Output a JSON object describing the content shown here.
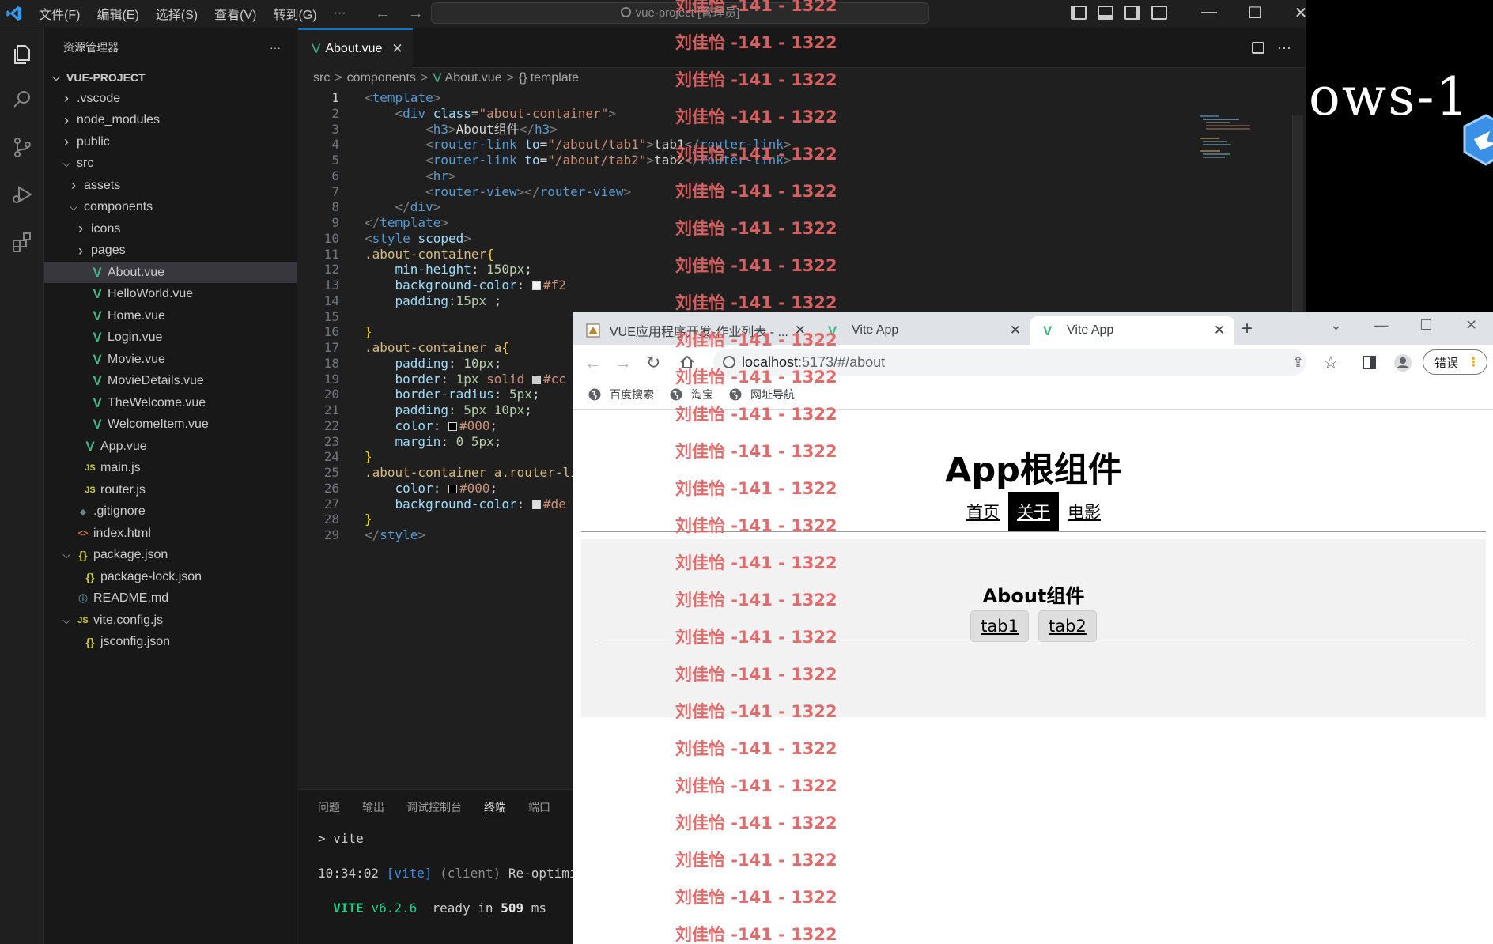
{
  "vscode": {
    "menu": [
      "文件(F)",
      "编辑(E)",
      "选择(S)",
      "查看(V)",
      "转到(G)"
    ],
    "more_label": "···",
    "nav_back": "←",
    "nav_forward": "→",
    "search_text": "vue-project [管理员]",
    "win_min": "—",
    "win_max": "☐",
    "win_close": "✕",
    "explorer_title": "资源管理器",
    "explorer_more": "···",
    "project_name": "VUE-PROJECT",
    "tree": [
      {
        "label": ".vscode",
        "kind": "folder",
        "open": false
      },
      {
        "label": "node_modules",
        "kind": "folder",
        "open": false
      },
      {
        "label": "public",
        "kind": "folder",
        "open": false
      },
      {
        "label": "src",
        "kind": "folder",
        "open": true
      },
      {
        "label": "assets",
        "kind": "folder",
        "open": false
      },
      {
        "label": "components",
        "kind": "folder",
        "open": true
      },
      {
        "label": "icons",
        "kind": "folder",
        "open": false
      },
      {
        "label": "pages",
        "kind": "folder",
        "open": false
      },
      {
        "label": "About.vue",
        "kind": "vue",
        "active": true
      },
      {
        "label": "HelloWorld.vue",
        "kind": "vue"
      },
      {
        "label": "Home.vue",
        "kind": "vue"
      },
      {
        "label": "Login.vue",
        "kind": "vue"
      },
      {
        "label": "Movie.vue",
        "kind": "vue"
      },
      {
        "label": "MovieDetails.vue",
        "kind": "vue"
      },
      {
        "label": "TheWelcome.vue",
        "kind": "vue"
      },
      {
        "label": "WelcomeItem.vue",
        "kind": "vue"
      },
      {
        "label": "App.vue",
        "kind": "vue"
      },
      {
        "label": "main.js",
        "kind": "js"
      },
      {
        "label": "router.js",
        "kind": "js"
      },
      {
        "label": ".gitignore",
        "kind": "git"
      },
      {
        "label": "index.html",
        "kind": "html"
      },
      {
        "label": "package.json",
        "kind": "json",
        "open": true
      },
      {
        "label": "package-lock.json",
        "kind": "json"
      },
      {
        "label": "README.md",
        "kind": "info"
      },
      {
        "label": "vite.config.js",
        "kind": "js",
        "open": true
      },
      {
        "label": "jsconfig.json",
        "kind": "json"
      }
    ],
    "tree_icons": {
      "vue": "V",
      "js": "JS",
      "json": "{}",
      "html": "<>",
      "info": "ⓘ",
      "git": "◆"
    },
    "tab_label": "About.vue",
    "tab_close": "✕",
    "breadcrumb": [
      "src",
      "components",
      "About.vue",
      "template"
    ],
    "breadcrumb_sep": ">",
    "code": [
      [
        [
          "brk",
          "<"
        ],
        [
          "tag",
          "template"
        ],
        [
          "brk",
          ">"
        ]
      ],
      [
        [
          "txt",
          "    "
        ],
        [
          "brk",
          "<"
        ],
        [
          "tag",
          "div"
        ],
        [
          "txt",
          " "
        ],
        [
          "attr",
          "class"
        ],
        [
          "txt",
          "="
        ],
        [
          "str",
          "\"about-container\""
        ],
        [
          "brk",
          ">"
        ]
      ],
      [
        [
          "txt",
          "        "
        ],
        [
          "brk",
          "<"
        ],
        [
          "tag",
          "h3"
        ],
        [
          "brk",
          ">"
        ],
        [
          "txt",
          "About组件"
        ],
        [
          "brk",
          "</"
        ],
        [
          "tag",
          "h3"
        ],
        [
          "brk",
          ">"
        ]
      ],
      [
        [
          "txt",
          "        "
        ],
        [
          "brk",
          "<"
        ],
        [
          "tag",
          "router-link"
        ],
        [
          "txt",
          " "
        ],
        [
          "attr",
          "to"
        ],
        [
          "txt",
          "="
        ],
        [
          "str",
          "\"/about/tab1\""
        ],
        [
          "brk",
          ">"
        ],
        [
          "txt",
          "tab1"
        ],
        [
          "brk",
          "</"
        ],
        [
          "tag",
          "router-link"
        ],
        [
          "brk",
          ">"
        ]
      ],
      [
        [
          "txt",
          "        "
        ],
        [
          "brk",
          "<"
        ],
        [
          "tag",
          "router-link"
        ],
        [
          "txt",
          " "
        ],
        [
          "attr",
          "to"
        ],
        [
          "txt",
          "="
        ],
        [
          "str",
          "\"/about/tab2\""
        ],
        [
          "brk",
          ">"
        ],
        [
          "txt",
          "tab2"
        ],
        [
          "brk",
          "</"
        ],
        [
          "tag",
          "router-link"
        ],
        [
          "brk",
          ">"
        ]
      ],
      [
        [
          "txt",
          "        "
        ],
        [
          "brk",
          "<"
        ],
        [
          "tag",
          "hr"
        ],
        [
          "brk",
          ">"
        ]
      ],
      [
        [
          "txt",
          "        "
        ],
        [
          "brk",
          "<"
        ],
        [
          "tag",
          "router-view"
        ],
        [
          "brk",
          "></"
        ],
        [
          "tag",
          "router-view"
        ],
        [
          "brk",
          ">"
        ]
      ],
      [
        [
          "txt",
          "    "
        ],
        [
          "brk",
          "</"
        ],
        [
          "tag",
          "div"
        ],
        [
          "brk",
          ">"
        ]
      ],
      [
        [
          "brk",
          "</"
        ],
        [
          "tag",
          "template"
        ],
        [
          "brk",
          ">"
        ]
      ],
      [
        [
          "brk",
          "<"
        ],
        [
          "tag",
          "style"
        ],
        [
          "txt",
          " "
        ],
        [
          "attr",
          "scoped"
        ],
        [
          "brk",
          ">"
        ]
      ],
      [
        [
          "sel",
          ".about-container"
        ],
        [
          "fold",
          "{"
        ]
      ],
      [
        [
          "txt",
          "    "
        ],
        [
          "attr",
          "min-height"
        ],
        [
          "txt",
          ": "
        ],
        [
          "num",
          "150px"
        ],
        [
          "txt",
          ";"
        ]
      ],
      [
        [
          "txt",
          "    "
        ],
        [
          "attr",
          "background-color"
        ],
        [
          "txt",
          ": "
        ],
        [
          "sw",
          "#f2f2f2"
        ],
        [
          "str",
          "#f2"
        ]
      ],
      [
        [
          "txt",
          "    "
        ],
        [
          "attr",
          "padding"
        ],
        [
          "txt",
          ":"
        ],
        [
          "num",
          "15px"
        ],
        [
          "txt",
          " ;"
        ]
      ],
      [],
      [
        [
          "fold",
          "}"
        ]
      ],
      [
        [
          "sel",
          ".about-container a"
        ],
        [
          "fold",
          "{"
        ]
      ],
      [
        [
          "txt",
          "    "
        ],
        [
          "attr",
          "padding"
        ],
        [
          "txt",
          ": "
        ],
        [
          "num",
          "10px"
        ],
        [
          "txt",
          ";"
        ]
      ],
      [
        [
          "txt",
          "    "
        ],
        [
          "attr",
          "border"
        ],
        [
          "txt",
          ": "
        ],
        [
          "num",
          "1px"
        ],
        [
          "txt",
          " "
        ],
        [
          "str",
          "solid"
        ],
        [
          "txt",
          " "
        ],
        [
          "sw",
          "#cccccc"
        ],
        [
          "str",
          "#cc"
        ]
      ],
      [
        [
          "txt",
          "    "
        ],
        [
          "attr",
          "border-radius"
        ],
        [
          "txt",
          ": "
        ],
        [
          "num",
          "5px"
        ],
        [
          "txt",
          ";"
        ]
      ],
      [
        [
          "txt",
          "    "
        ],
        [
          "attr",
          "padding"
        ],
        [
          "txt",
          ": "
        ],
        [
          "num",
          "5px 10px"
        ],
        [
          "txt",
          ";"
        ]
      ],
      [
        [
          "txt",
          "    "
        ],
        [
          "attr",
          "color"
        ],
        [
          "txt",
          ": "
        ],
        [
          "sw",
          "#000000"
        ],
        [
          "str",
          "#000"
        ],
        [
          "txt",
          ";"
        ]
      ],
      [
        [
          "txt",
          "    "
        ],
        [
          "attr",
          "margin"
        ],
        [
          "txt",
          ": "
        ],
        [
          "num",
          "0 5px"
        ],
        [
          "txt",
          ";"
        ]
      ],
      [
        [
          "fold",
          "}"
        ]
      ],
      [
        [
          "sel",
          ".about-container a.router-li"
        ]
      ],
      [
        [
          "txt",
          "    "
        ],
        [
          "attr",
          "color"
        ],
        [
          "txt",
          ": "
        ],
        [
          "sw",
          "#000000"
        ],
        [
          "str",
          "#000"
        ],
        [
          "txt",
          ";"
        ]
      ],
      [
        [
          "txt",
          "    "
        ],
        [
          "attr",
          "background-color"
        ],
        [
          "txt",
          ": "
        ],
        [
          "sw",
          "#dedede"
        ],
        [
          "str",
          "#de"
        ]
      ],
      [
        [
          "fold",
          "}"
        ]
      ],
      [
        [
          "brk",
          "</"
        ],
        [
          "tag",
          "style"
        ],
        [
          "brk",
          ">"
        ]
      ]
    ],
    "panel_tabs": [
      "问题",
      "输出",
      "调试控制台",
      "终端",
      "端口"
    ],
    "panel_active": "终端",
    "terminal": {
      "l1": "> vite",
      "l2_time": "10:34:02",
      "l2_tag": "[vite]",
      "l2_client": "(client)",
      "l2_msg": "Re-optimizi",
      "l3_vite": "VITE",
      "l3_ver": "v6.2.6",
      "l3_ready": "ready in",
      "l3_ms": "509",
      "l3_unit": "ms"
    }
  },
  "desktop": {
    "text": "ows-1"
  },
  "browser": {
    "tabs": [
      {
        "title": "VUE应用程序开发-作业列表 - ..."
      },
      {
        "title": "Vite App"
      },
      {
        "title": "Vite App",
        "active": true
      }
    ],
    "tab_close": "✕",
    "new_tab": "+",
    "url_host": "localhost",
    "url_path": ":5173/#/about",
    "error_label": "错误",
    "error_dots": "⋮",
    "bookmarks": [
      "百度搜索",
      "淘宝",
      "网址导航"
    ],
    "win_min": "—",
    "win_max": "☐",
    "win_close": "✕",
    "win_dropdown": "⌄"
  },
  "app": {
    "title": "App根组件",
    "nav": [
      {
        "label": "首页",
        "active": false
      },
      {
        "label": "关于",
        "active": true
      },
      {
        "label": "电影",
        "active": false
      }
    ],
    "about_title": "About组件",
    "links": [
      "tab1",
      "tab2"
    ]
  },
  "watermark": {
    "text": "刘佳怡 -141 - 1322",
    "count": 26
  },
  "colors": {
    "accent": "#0078d4",
    "vue_green": "#41b883",
    "watermark": "#e06464"
  }
}
